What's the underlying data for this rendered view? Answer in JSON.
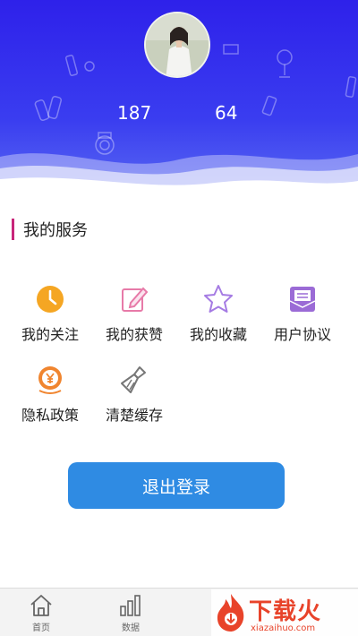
{
  "profile": {
    "stat_following": "187",
    "stat_likes": "64"
  },
  "services": {
    "title": "我的服务",
    "items": [
      {
        "label": "我的关注",
        "icon": "clock-icon",
        "color": "#f5a623"
      },
      {
        "label": "我的获赞",
        "icon": "edit-icon",
        "color": "#e77aa8"
      },
      {
        "label": "我的收藏",
        "icon": "star-icon",
        "color": "#a57be3"
      },
      {
        "label": "用户协议",
        "icon": "mail-icon",
        "color": "#9b6bd6"
      },
      {
        "label": "隐私政策",
        "icon": "yen-coin-icon",
        "color": "#f0852f"
      },
      {
        "label": "清楚缓存",
        "icon": "broom-icon",
        "color": "#777777"
      }
    ]
  },
  "logout": {
    "label": "退出登录",
    "color": "#2f8be3"
  },
  "tabbar": {
    "tabs": [
      {
        "label": "首页",
        "icon": "home-icon"
      },
      {
        "label": "数据",
        "icon": "bar-chart-icon"
      }
    ]
  },
  "watermark": {
    "text": "下载火",
    "url": "xiazaihuo.com"
  },
  "colors": {
    "header": "#2e21ea",
    "accent": "#c8257a"
  }
}
